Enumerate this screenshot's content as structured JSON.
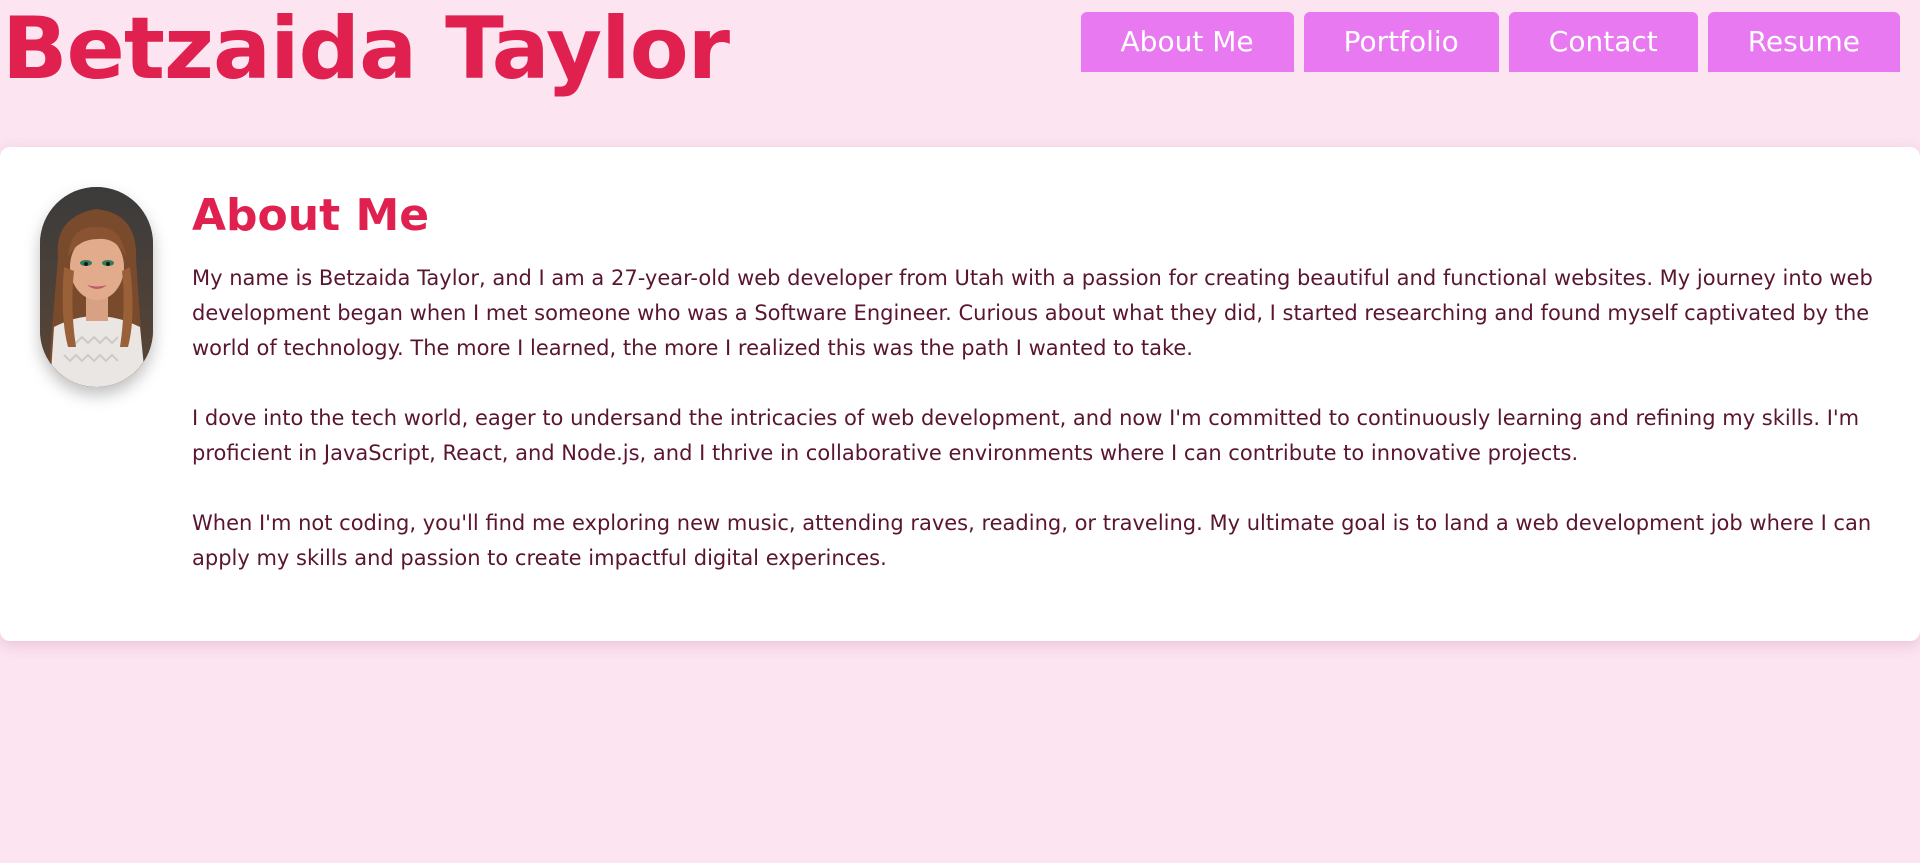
{
  "header": {
    "title": "Betzaida Taylor",
    "nav": [
      {
        "label": "About Me"
      },
      {
        "label": "Portfolio"
      },
      {
        "label": "Contact"
      },
      {
        "label": "Resume"
      }
    ]
  },
  "about": {
    "heading": "About Me",
    "paragraphs": [
      "My name is Betzaida Taylor, and I am a 27-year-old web developer from Utah with a passion for creating beautiful and functional websites. My journey into web development began when I met someone who was a Software Engineer. Curious about what they did, I started researching and found myself captivated by the world of technology. The more I learned, the more I realized this was the path I wanted to take.",
      "I dove into the tech world, eager to undersand the intricacies of web development, and now I'm committed to continuously learning and refining my skills. I'm proficient in JavaScript, React, and Node.js, and I thrive in collaborative environments where I can contribute to innovative projects.",
      "When I'm not coding, you'll find me exploring new music, attending raves, reading, or traveling. My ultimate goal is to land a web development job where I can apply my skills and passion to create impactful digital experinces."
    ]
  },
  "colors": {
    "background": "#fce4f1",
    "accent": "#e0204f",
    "nav_button": "#e879f0",
    "body_text": "#5a1530"
  }
}
